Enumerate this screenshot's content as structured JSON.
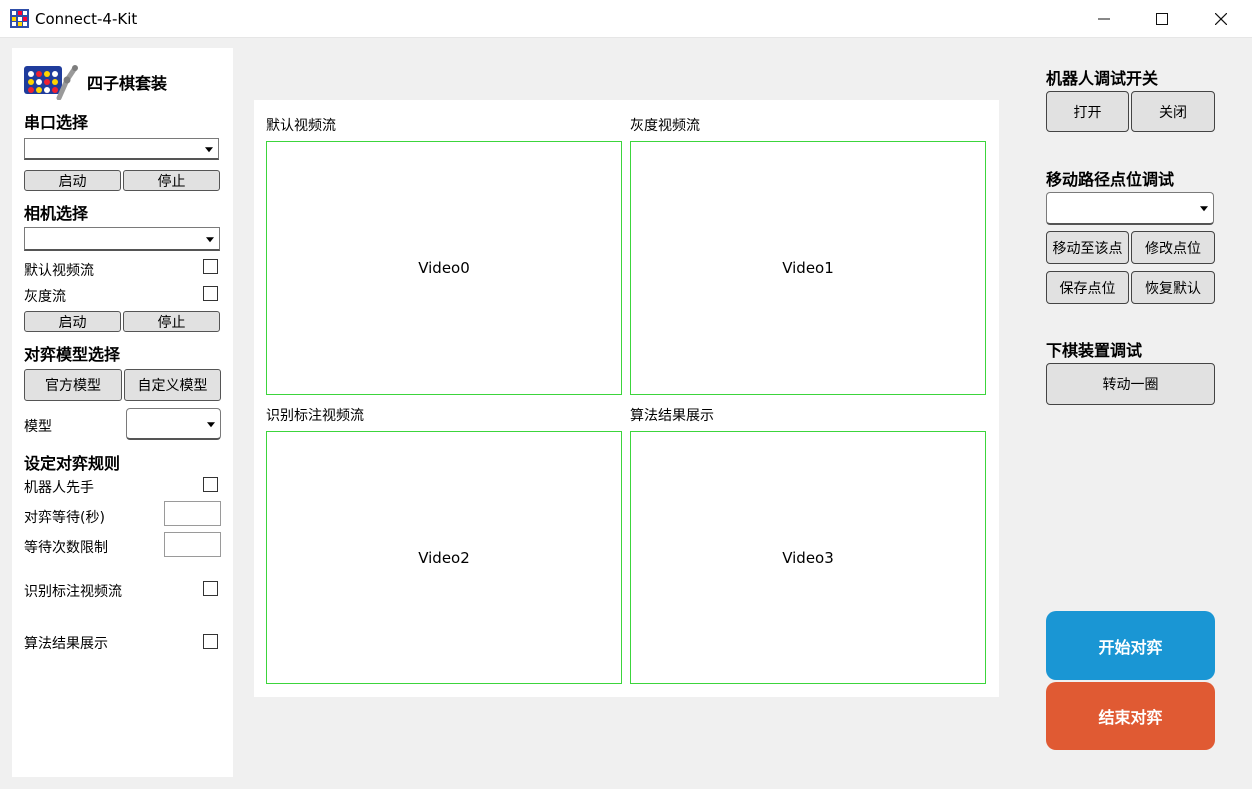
{
  "window": {
    "title": "Connect-4-Kit"
  },
  "icons": {
    "app": "app-grid-icon",
    "minimize": "minimize-icon",
    "maximize": "maximize-icon",
    "close": "close-icon"
  },
  "colors": {
    "start_game": "#1a96d4",
    "end_game": "#e05a33",
    "video_border": "#3cd53c"
  },
  "left": {
    "brand": "四子棋套装",
    "serial": {
      "title": "串口选择",
      "start": "启动",
      "stop": "停止"
    },
    "camera": {
      "title": "相机选择",
      "default_stream": "默认视频流",
      "gray_stream": "灰度流",
      "start": "启动",
      "stop": "停止"
    },
    "model": {
      "title": "对弈模型选择",
      "official": "官方模型",
      "custom": "自定义模型",
      "model_label": "模型"
    },
    "rules": {
      "title": "设定对弈规则",
      "robot_first": "机器人先手",
      "wait_seconds": "对弈等待(秒)",
      "wait_limit": "等待次数限制",
      "annotated_stream": "识别标注视频流",
      "algo_result": "算法结果展示"
    }
  },
  "videos": [
    {
      "label": "默认视频流",
      "name": "Video0"
    },
    {
      "label": "灰度视频流",
      "name": "Video1"
    },
    {
      "label": "识别标注视频流",
      "name": "Video2"
    },
    {
      "label": "算法结果展示",
      "name": "Video3"
    }
  ],
  "right": {
    "robot_debug": {
      "title": "机器人调试开关",
      "open": "打开",
      "close": "关闭"
    },
    "path_debug": {
      "title": "移动路径点位调试",
      "move_to": "移动至该点",
      "modify": "修改点位",
      "save": "保存点位",
      "restore": "恢复默认"
    },
    "drop_debug": {
      "title": "下棋装置调试",
      "rotate": "转动一圈"
    },
    "start_game": "开始对弈",
    "end_game": "结束对弈"
  }
}
